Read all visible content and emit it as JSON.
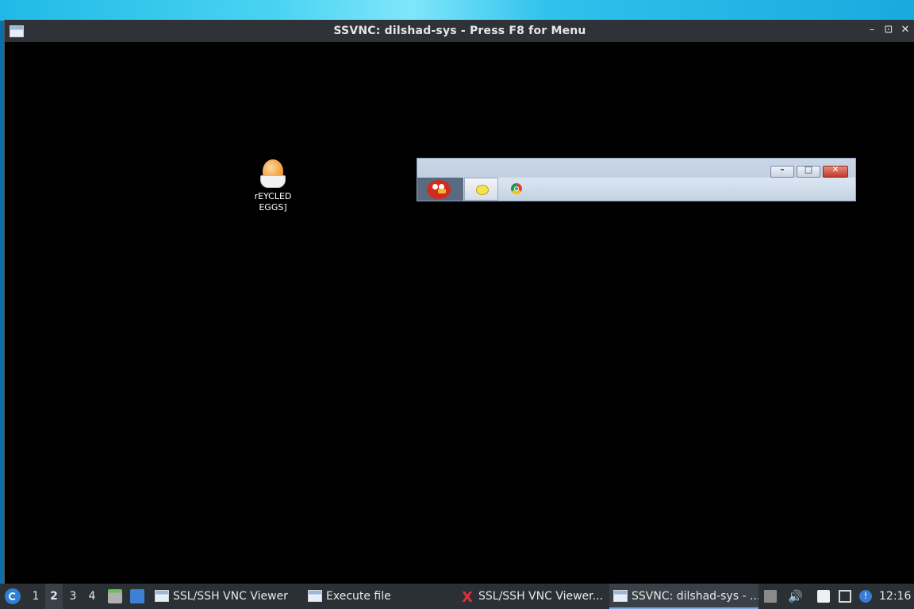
{
  "window": {
    "title": "SSVNC: dilshad-sys - Press F8 for Menu",
    "minimize_glyph": "–",
    "maximize_glyph": "⊡",
    "close_glyph": "✕"
  },
  "remote_desktop": {
    "icon": {
      "name": "egg-icon",
      "label_line1": "rEYCLED",
      "label_line2": "EGGS]"
    },
    "mini_window": {
      "close_glyph": "✕",
      "min_glyph": "–",
      "max_glyph": "□",
      "items": [
        "angry-birds-icon",
        "folder-icon",
        "chrome-icon"
      ]
    }
  },
  "taskbar": {
    "workspaces": [
      "1",
      "2",
      "3",
      "4"
    ],
    "active_workspace": "2",
    "tasks": [
      {
        "label": "SSL/SSH VNC Viewer",
        "icon": "window-icon"
      },
      {
        "label": "Execute file",
        "icon": "window-icon"
      },
      {
        "label": "SSL/SSH VNC Viewer...",
        "icon": "x-icon"
      },
      {
        "label": "SSVNC: dilshad-sys - ...",
        "icon": "window-icon",
        "active": true
      }
    ],
    "clock": "12:16",
    "volume_glyph": "🔊",
    "info_glyph": "!"
  },
  "colors": {
    "taskbar_bg": "#2b3035",
    "titlebar_bg": "#2f3338",
    "accent": "#7ca9e0"
  }
}
